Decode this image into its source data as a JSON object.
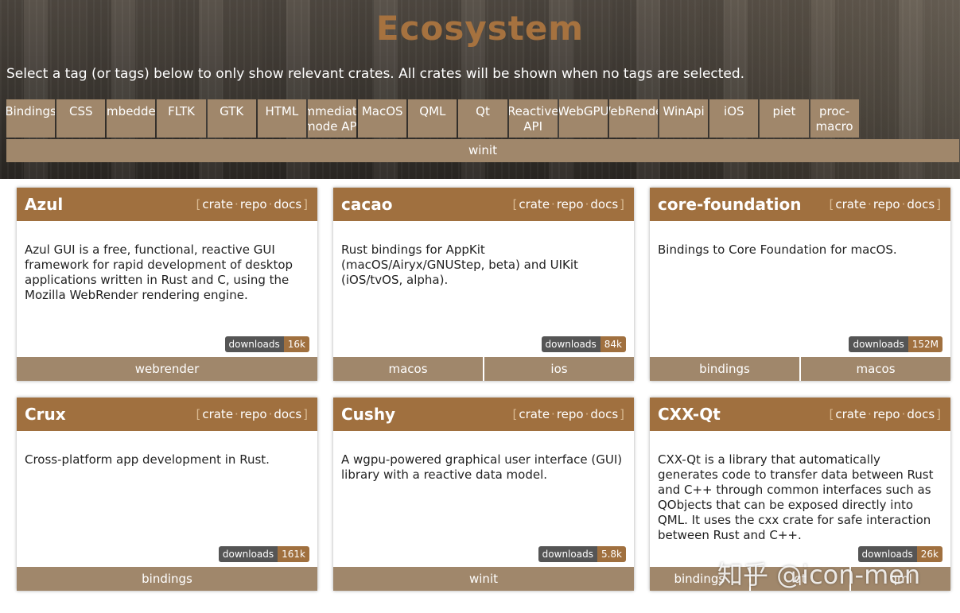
{
  "page": {
    "title": "Ecosystem",
    "subtitle": "Select a tag (or tags) below to only show relevant crates. All crates will be shown when no tags are selected."
  },
  "tags": [
    "Bindings",
    "CSS",
    "Embedded",
    "FLTK",
    "GTK",
    "HTML",
    "Immediate mode API",
    "MacOS",
    "QML",
    "Qt",
    "Reactive API",
    "WebGPU",
    "WebRender",
    "WinApi",
    "iOS",
    "piet",
    "proc-macro",
    "winit"
  ],
  "link_labels": {
    "crate": "crate",
    "repo": "repo",
    "docs": "docs"
  },
  "downloads_label": "downloads",
  "crates": [
    {
      "name": "Azul",
      "description": "Azul GUI is a free, functional, reactive GUI framework for rapid development of desktop applications written in Rust and C, using the Mozilla WebRender rendering engine.",
      "downloads": "16k",
      "tags": [
        "webrender"
      ]
    },
    {
      "name": "cacao",
      "description": "Rust bindings for AppKit (macOS/Airyx/GNUStep, beta) and UIKit (iOS/tvOS, alpha).",
      "downloads": "84k",
      "tags": [
        "macos",
        "ios"
      ]
    },
    {
      "name": "core-foundation",
      "description": "Bindings to Core Foundation for macOS.",
      "downloads": "152M",
      "tags": [
        "bindings",
        "macos"
      ]
    },
    {
      "name": "Crux",
      "description": "Cross-platform app development in Rust.",
      "downloads": "161k",
      "tags": [
        "bindings"
      ]
    },
    {
      "name": "Cushy",
      "description": "A wgpu-powered graphical user interface (GUI) library with a reactive data model.",
      "downloads": "5.8k",
      "tags": [
        "winit"
      ]
    },
    {
      "name": "CXX-Qt",
      "description": "CXX-Qt is a library that automatically generates code to transfer data between Rust and C++ through common interfaces such as QObjects that can be exposed directly into QML. It uses the cxx crate for safe interaction between Rust and C++.",
      "downloads": "26k",
      "tags": [
        "bindings",
        "qt",
        "qml"
      ]
    }
  ],
  "watermark": "知乎 @icon-men",
  "colors": {
    "accent": "#a0703f",
    "tag_bg": "#a0876b",
    "title": "#a6723f",
    "badge_key": "#555555"
  }
}
